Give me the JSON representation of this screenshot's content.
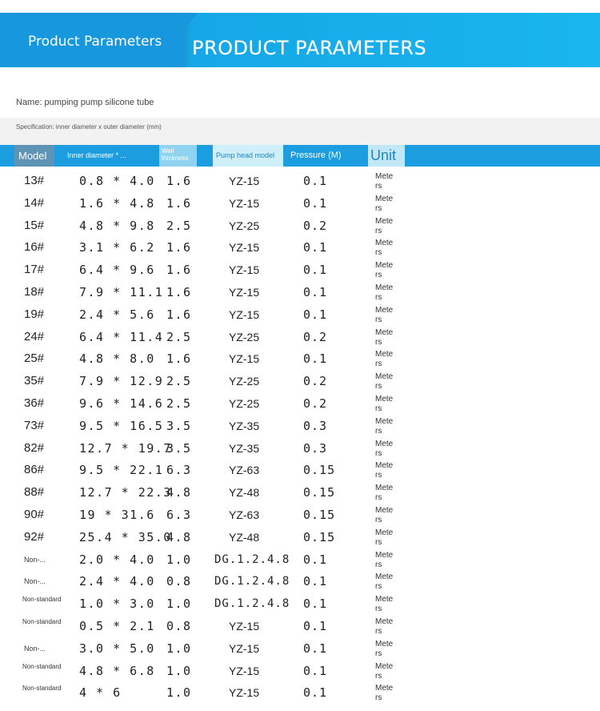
{
  "banner": {
    "title": "Product Parameters",
    "subtitle": "PRODUCT PARAMETERS"
  },
  "name_line": "Name: pumping pump silicone tube",
  "spec_line": "Specification: inner diameter x outer diameter (mm)",
  "table": {
    "headers": {
      "model": "Model",
      "inner": "Inner diameter * ...",
      "wall": "Wall thickness",
      "pump": "Pump head model",
      "pressure": "Pressure (M)",
      "unit": "Unit"
    },
    "rows": [
      {
        "model": "13#",
        "inner": "0.8 * 4.0",
        "wall": "1.6",
        "pump": "YZ-15",
        "pressure": "0.1",
        "unit": "Meters"
      },
      {
        "model": "14#",
        "inner": "1.6 * 4.8",
        "wall": "1.6",
        "pump": "YZ-15",
        "pressure": "0.1",
        "unit": "Meters"
      },
      {
        "model": "15#",
        "inner": "4.8 * 9.8",
        "wall": "2.5",
        "pump": "YZ-25",
        "pressure": "0.2",
        "unit": "Meters"
      },
      {
        "model": "16#",
        "inner": "3.1 * 6.2",
        "wall": "1.6",
        "pump": "YZ-15",
        "pressure": "0.1",
        "unit": "Meters"
      },
      {
        "model": "17#",
        "inner": "6.4 * 9.6",
        "wall": "1.6",
        "pump": "YZ-15",
        "pressure": "0.1",
        "unit": "Meters"
      },
      {
        "model": "18#",
        "inner": "7.9 * 11.1",
        "wall": "1.6",
        "pump": "YZ-15",
        "pressure": "0.1",
        "unit": "Meters"
      },
      {
        "model": "19#",
        "inner": "2.4 * 5.6",
        "wall": "1.6",
        "pump": "YZ-15",
        "pressure": "0.1",
        "unit": "Meters"
      },
      {
        "model": "24#",
        "inner": "6.4 * 11.4",
        "wall": "2.5",
        "pump": "YZ-25",
        "pressure": "0.2",
        "unit": "Meters"
      },
      {
        "model": "25#",
        "inner": "4.8 * 8.0",
        "wall": "1.6",
        "pump": "YZ-15",
        "pressure": "0.1",
        "unit": "Meters"
      },
      {
        "model": "35#",
        "inner": "7.9 * 12.9",
        "wall": "2.5",
        "pump": "YZ-25",
        "pressure": "0.2",
        "unit": "Meters"
      },
      {
        "model": "36#",
        "inner": "9.6 * 14.6",
        "wall": "2.5",
        "pump": "YZ-25",
        "pressure": "0.2",
        "unit": "Meters"
      },
      {
        "model": "73#",
        "inner": "9.5 * 16.5",
        "wall": "3.5",
        "pump": "YZ-35",
        "pressure": "0.3",
        "unit": "Meters"
      },
      {
        "model": "82#",
        "inner": "12.7 * 19.7",
        "wall": "3.5",
        "pump": "YZ-35",
        "pressure": "0.3",
        "unit": "Meters"
      },
      {
        "model": "86#",
        "inner": "9.5 * 22.1",
        "wall": "6.3",
        "pump": "YZ-63",
        "pressure": "0.15",
        "unit": "Meters"
      },
      {
        "model": "88#",
        "inner": "12.7 * 22.3",
        "wall": "4.8",
        "pump": "YZ-48",
        "pressure": "0.15",
        "unit": "Meters"
      },
      {
        "model": "90#",
        "inner": "19 * 31.6",
        "wall": "6.3",
        "pump": "YZ-63",
        "pressure": "0.15",
        "unit": "Meters"
      },
      {
        "model": "92#",
        "inner": "25.4 * 35.0",
        "wall": "4.8",
        "pump": "YZ-48",
        "pressure": "0.15",
        "unit": "Meters"
      },
      {
        "model": "Non-...",
        "inner": "2.0 * 4.0",
        "wall": "1.0",
        "pump": "DG.1.2.4.8",
        "pressure": "0.1",
        "unit": "Meters"
      },
      {
        "model": "Non-...",
        "inner": "2.4 * 4.0",
        "wall": "0.8",
        "pump": "DG.1.2.4.8",
        "pressure": "0.1",
        "unit": "Meters"
      },
      {
        "model": "Non-standard",
        "inner": "1.0 * 3.0",
        "wall": "1.0",
        "pump": "DG.1.2.4.8",
        "pressure": "0.1",
        "unit": "Meters"
      },
      {
        "model": "Non-standard",
        "inner": "0.5 * 2.1",
        "wall": "0.8",
        "pump": "YZ-15",
        "pressure": "0.1",
        "unit": "Meters"
      },
      {
        "model": "Non-...",
        "inner": "3.0 * 5.0",
        "wall": "1.0",
        "pump": "YZ-15",
        "pressure": "0.1",
        "unit": "Meters"
      },
      {
        "model": "Non-standard",
        "inner": "4.8 * 6.8",
        "wall": "1.0",
        "pump": "YZ-15",
        "pressure": "0.1",
        "unit": "Meters"
      },
      {
        "model": "Non-standard",
        "inner": "4 * 6",
        "wall": "1.0",
        "pump": "YZ-15",
        "pressure": "0.1",
        "unit": "Meters"
      }
    ]
  }
}
